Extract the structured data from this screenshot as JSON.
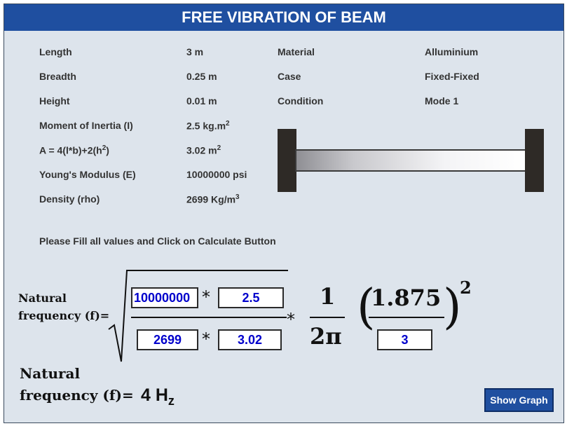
{
  "title": "FREE VIBRATION OF BEAM",
  "params_left": [
    {
      "label": "Length",
      "value": "3 m",
      "unit_sup": ""
    },
    {
      "label": "Breadth",
      "value": "0.25 m",
      "unit_sup": ""
    },
    {
      "label": "Height",
      "value": "0.01 m",
      "unit_sup": ""
    },
    {
      "label": "Moment of Inertia (I)",
      "value": "2.5 kg.m",
      "unit_sup": "2"
    },
    {
      "label_pre": "A = 4(l*b)+2(h",
      "label_sup": "2",
      "label_post": ")",
      "value": "3.02 m",
      "unit_sup": "2"
    },
    {
      "label": "Young's Modulus (E)",
      "value": "10000000 psi",
      "unit_sup": ""
    },
    {
      "label": "Density (rho)",
      "value": "2699 Kg/m",
      "unit_sup": "3"
    }
  ],
  "params_right": [
    {
      "label": "Material",
      "value": "Alluminium"
    },
    {
      "label": "Case",
      "value": "Fixed-Fixed"
    },
    {
      "label": "Condition",
      "value": "Mode 1"
    }
  ],
  "instruction": "Please Fill all values and Click on Calculate Button",
  "formula": {
    "label_line1": "Natural",
    "label_line2": "frequency (f)=",
    "inputs": {
      "youngs_modulus": "10000000",
      "moment_of_inertia": "2.5",
      "density": "2699",
      "area": "3.02",
      "length": "3"
    },
    "multiply": "*",
    "one": "1",
    "two_pi": "2π",
    "constant": "1.875",
    "exponent": "2",
    "open_paren": "(",
    "close_paren": ")"
  },
  "result": {
    "label_line1": "Natural",
    "label_line2": "frequency (f)=",
    "value": "4 H",
    "unit_sub": "z"
  },
  "buttons": {
    "show_graph": "Show Graph"
  },
  "colors": {
    "title_bar": "#1f4fa0",
    "background": "#dde4ec",
    "input_text": "#0000cc",
    "button": "#1f4fa0"
  }
}
